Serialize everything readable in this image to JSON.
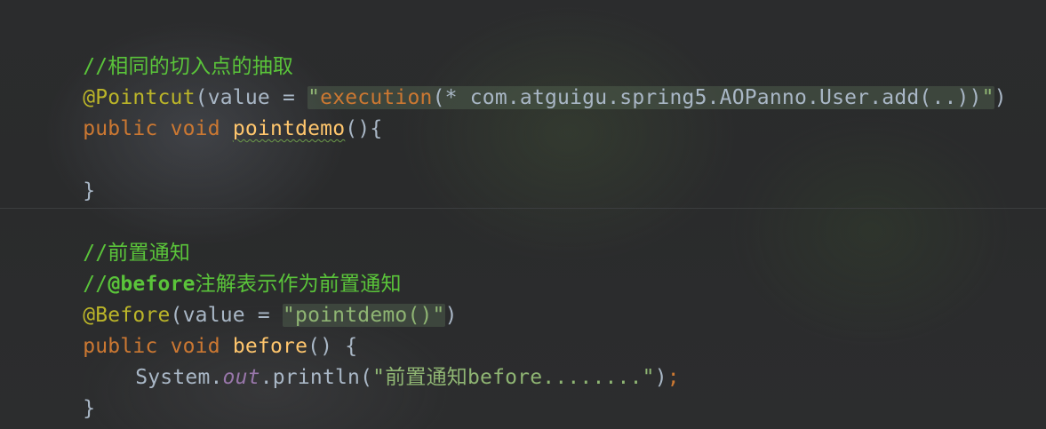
{
  "code": {
    "section1": {
      "comment": "//相同的切入点的抽取",
      "pointcut_annotation": "@Pointcut",
      "pointcut_open": "(value = ",
      "pointcut_quote_open": "\"",
      "pointcut_execution": "execution",
      "pointcut_expression_rest": "(* com.atguigu.spring5.AOPanno.User.add(..))",
      "pointcut_quote_close": "\"",
      "pointcut_close": ")",
      "method_modifier": "public",
      "method_return": "void",
      "method_name": "pointdemo",
      "method_params": "(){",
      "method_close": "}"
    },
    "section2": {
      "comment1": "//前置通知",
      "comment2_prefix": "//",
      "comment2_annotation": "@before",
      "comment2_rest": "注解表示作为前置通知",
      "before_annotation": "@Before",
      "before_open": "(value = ",
      "before_string": "\"pointdemo()\"",
      "before_close": ")",
      "method_modifier": "public",
      "method_return": "void",
      "method_name": "before",
      "method_params": "() {",
      "body_system": "System.",
      "body_out": "out",
      "body_println": ".println(",
      "body_string": "\"前置通知before........\"",
      "body_close": ")",
      "body_semicolon": ";",
      "method_close": "}"
    }
  },
  "colors": {
    "comment": "#5ac43a",
    "annotation": "#bbb529",
    "keyword": "#cc7832",
    "method_name": "#ffc66d",
    "string": "#8fb573",
    "plain": "#a9b7c6",
    "static_field": "#9876aa"
  }
}
